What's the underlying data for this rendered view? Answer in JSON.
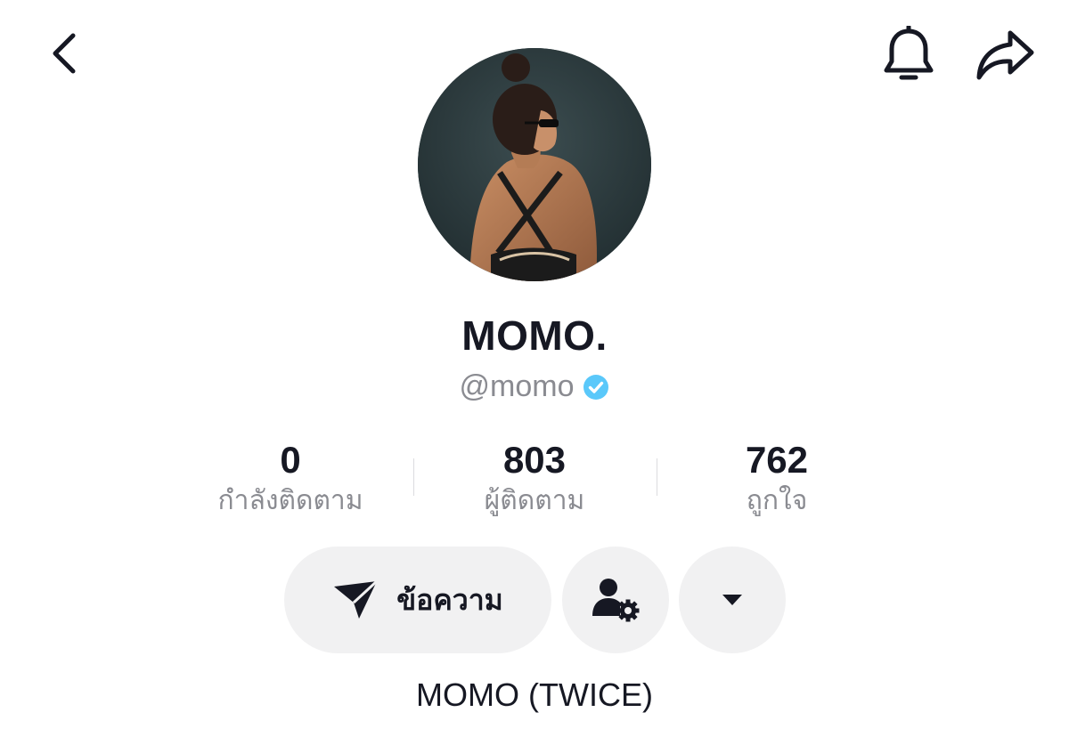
{
  "header": {
    "back_icon": "chevron-left-icon",
    "notification_icon": "bell-icon",
    "share_icon": "share-arrow-icon"
  },
  "profile": {
    "display_name": "MOMO.",
    "handle": "@momo",
    "verified": true,
    "verified_color": "#5ac8fa",
    "bio": "MOMO (TWICE)"
  },
  "stats": [
    {
      "value": "0",
      "label": "กำลังติดตาม"
    },
    {
      "value": "803",
      "label": "ผู้ติดตาม"
    },
    {
      "value": "762",
      "label": "ถูกใจ"
    }
  ],
  "actions": {
    "message_label": "ข้อความ",
    "message_icon": "send-icon",
    "add_friend_icon": "user-gear-icon",
    "more_icon": "caret-down-icon"
  },
  "colors": {
    "text_primary": "#161823",
    "text_secondary": "#8a8b91",
    "button_bg": "#f1f1f2"
  }
}
